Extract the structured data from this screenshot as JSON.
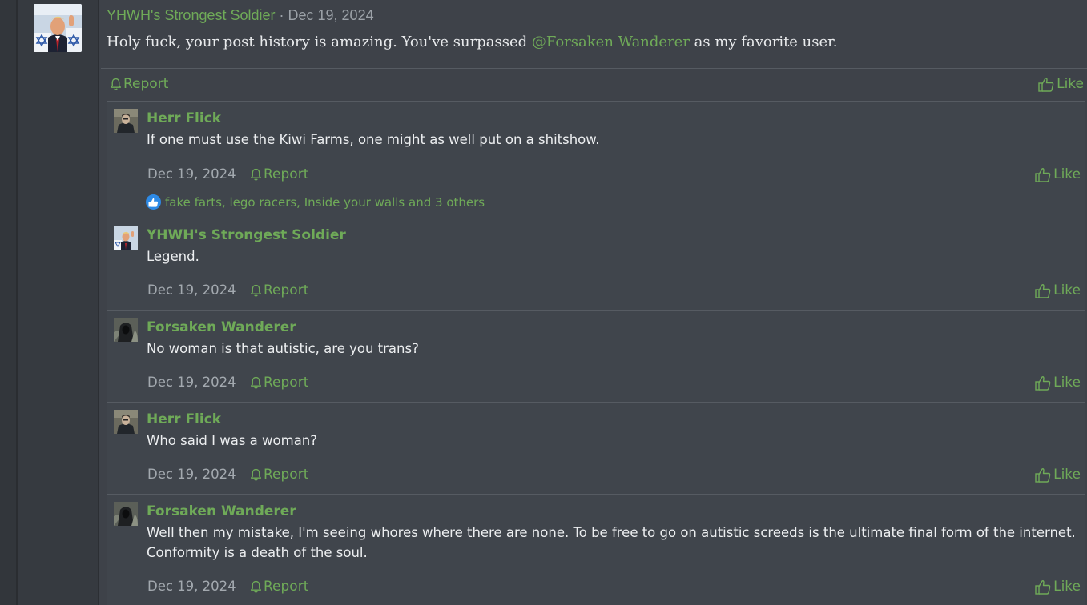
{
  "post": {
    "author": "YHWH's Strongest Soldier",
    "separator": " · ",
    "date": "Dec 19, 2024",
    "body_before": "Holy fuck, your post history is amazing. You've surpassed ",
    "mention": "@Forsaken Wanderer",
    "body_after": " as my favorite user.",
    "report_label": "Report",
    "like_label": "Like"
  },
  "comments": [
    {
      "author": "Herr Flick",
      "text": "If one must use the Kiwi Farms, one might as well put on a shitshow.",
      "date": "Dec 19, 2024",
      "report_label": "Report",
      "like_label": "Like",
      "reactions": "fake farts, lego racers, Inside your walls and 3 others"
    },
    {
      "author": "YHWH's Strongest Soldier",
      "text": "Legend.",
      "date": "Dec 19, 2024",
      "report_label": "Report",
      "like_label": "Like"
    },
    {
      "author": "Forsaken Wanderer",
      "text": "No woman is that autistic, are you trans?",
      "date": "Dec 19, 2024",
      "report_label": "Report",
      "like_label": "Like"
    },
    {
      "author": "Herr Flick",
      "text": "Who said I was a woman?",
      "date": "Dec 19, 2024",
      "report_label": "Report",
      "like_label": "Like"
    },
    {
      "author": "Forsaken Wanderer",
      "text": "Well then my mistake, I'm seeing whores where there are none. To be free to go on autistic screeds is the ultimate final form of the internet. Conformity is a death of the soul.",
      "date": "Dec 19, 2024",
      "report_label": "Report",
      "like_label": "Like"
    }
  ],
  "icons": {
    "report": "bell-icon",
    "like": "thumbs-up-icon",
    "reaction": "like-reaction-icon"
  },
  "colors": {
    "accent": "#6faa58",
    "background": "#3e4249",
    "comment_background": "#40454c",
    "reaction_blue": "#2d8ae6"
  }
}
